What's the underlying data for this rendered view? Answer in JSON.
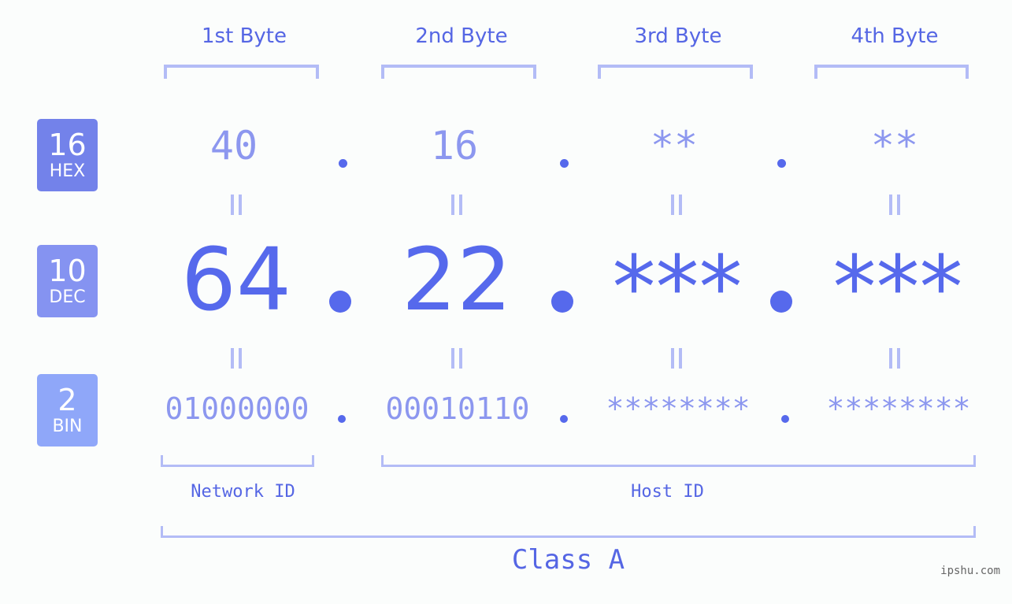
{
  "bases": [
    {
      "num": "16",
      "label": "HEX",
      "color": "#7382ea"
    },
    {
      "num": "10",
      "label": "DEC",
      "color": "#8593f1"
    },
    {
      "num": "2",
      "label": "BIN",
      "color": "#8fa7f9"
    }
  ],
  "byte_headers": [
    "1st Byte",
    "2nd Byte",
    "3rd Byte",
    "4th Byte"
  ],
  "hex": [
    "40",
    "16",
    "**",
    "**"
  ],
  "dec": [
    "64",
    "22",
    "***",
    "***"
  ],
  "bin": [
    "01000000",
    "00010110",
    "********",
    "********"
  ],
  "labels": {
    "network_id": "Network ID",
    "host_id": "Host ID",
    "class": "Class A"
  },
  "watermark": "ipshu.com",
  "colors": {
    "accent": "#5669ec",
    "light_value": "#8c97ef",
    "bracket": "#b3bcf6",
    "text": "#5566e4"
  }
}
